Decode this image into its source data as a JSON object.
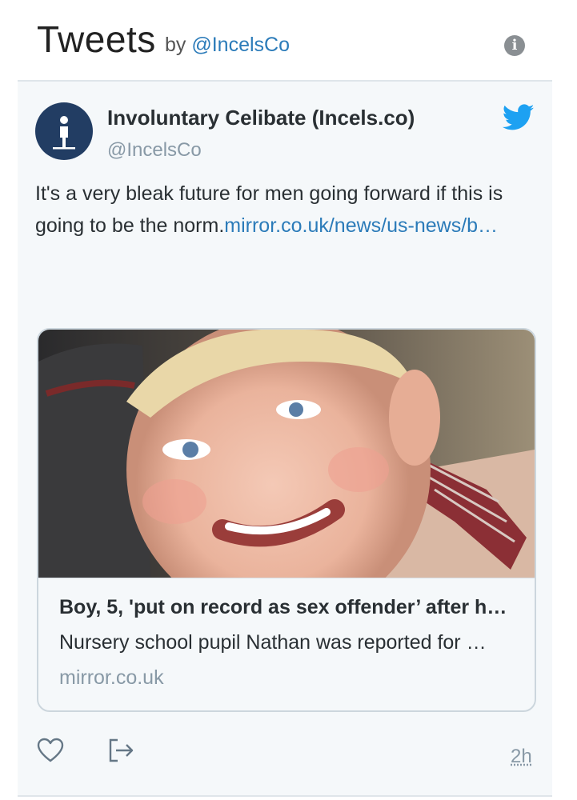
{
  "header": {
    "title": "Tweets",
    "by_prefix": "by",
    "handle": "@IncelsCo",
    "info_icon": "info-icon"
  },
  "tweet": {
    "author_name": "Involuntary Celibate (Incels.co)",
    "author_handle": "@IncelsCo",
    "text": "It's a very bleak future for men going forward if this is going to be the norm.",
    "link": "mirror.co.uk/news/us-news/b…",
    "card": {
      "title": "Boy, 5, 'put on record as sex offender’ after h…",
      "description": "Nursery school pupil Nathan was reported for …",
      "domain": "mirror.co.uk"
    },
    "timestamp": "2h",
    "icons": [
      "heart-icon",
      "share-icon",
      "twitter-bird-icon"
    ]
  },
  "colors": {
    "link": "#2b7bb9",
    "panel_bg": "#f5f8fa",
    "avatar_bg": "#223d63",
    "twitter_blue": "#1da1f2"
  }
}
